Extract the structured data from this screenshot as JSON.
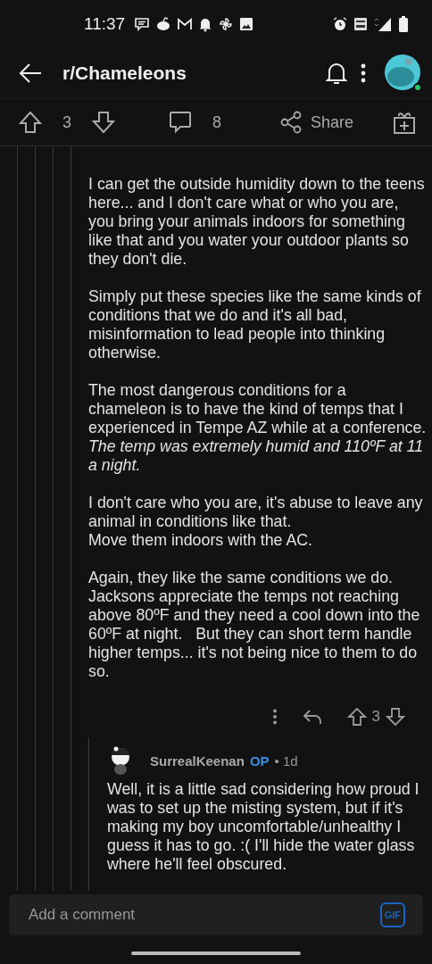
{
  "status_bar": {
    "time": "11:37"
  },
  "app_bar": {
    "title": "r/Chameleons"
  },
  "post_actions": {
    "upvotes": "3",
    "comments": "8",
    "share": "Share"
  },
  "comment": {
    "paragraphs": [
      [
        "I can get the outside humidity down to the teens here... and I don't care what or who you are, you bring your animals indoors for something like that and you water your outdoor plants so they don't die."
      ],
      [
        "Simply put these species like the same kinds of conditions that we do and it's all bad, misinformation to lead people into thinking otherwise."
      ],
      [
        "The most dangerous conditions for a chameleon is to have the kind of temps that I experienced in Tempe AZ while at a conference. *The temp was extremely humid and 110ºF at 11 a night.*"
      ],
      [
        "I don't care who you are, it's abuse to leave any animal in conditions like that.",
        "Move them indoors with the AC."
      ],
      [
        "Again, they like the same conditions we do. Jacksons appreciate the temps not reaching above 80ºF and they need a cool down into the 60ºF at night.   But they can short term handle higher temps... it's not being nice to them to do so."
      ]
    ],
    "score": "3"
  },
  "reply": {
    "author": "SurrealKeenan",
    "badge": "OP",
    "age": "• 1d",
    "text": "Well, it is a little sad considering how proud I was to set up the misting system, but if it's making my boy uncomfortable/unhealthy I guess it has to go. :(  I'll hide the water glass where he'll feel obscured."
  },
  "composer": {
    "placeholder": "Add a comment",
    "gif": "GIF"
  }
}
